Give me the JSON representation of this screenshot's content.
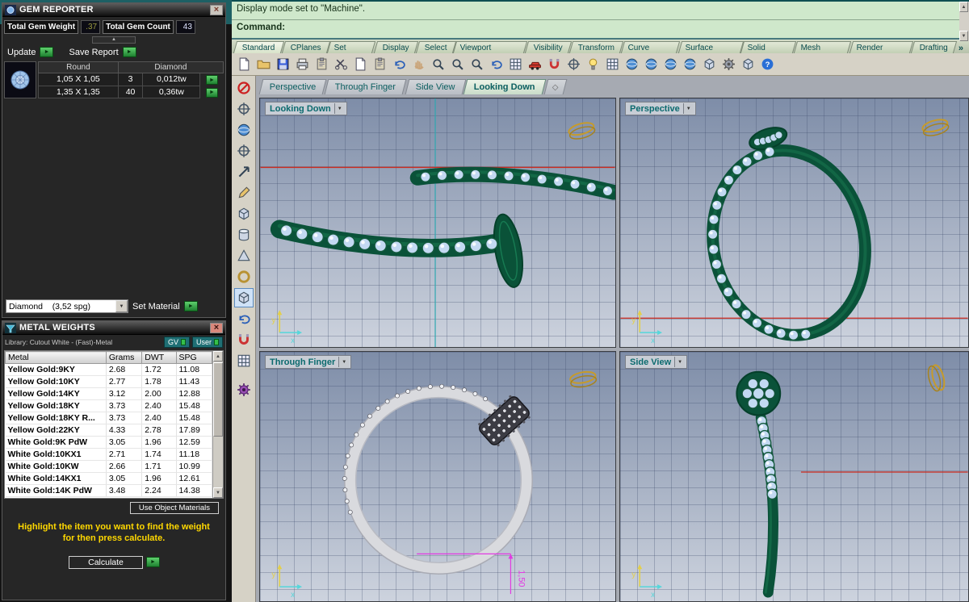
{
  "colors": {
    "accent_green": "#33a02c",
    "status_green": "#cfe8cb",
    "teal_text": "#0b5e60",
    "ring_green": "#0a5239",
    "gem_blue": "#c3d9f2",
    "gold": "#c79b2a",
    "magenta": "#e23ae2",
    "axis_red": "#cc2a1e"
  },
  "gem_reporter": {
    "title": "GEM REPORTER",
    "close_label": "×",
    "total_weight_label": "Total Gem Weight",
    "total_weight_value": ".37",
    "total_count_label": "Total Gem Count",
    "total_count_value": "43",
    "update_label": "Update",
    "save_report_label": "Save Report",
    "table": {
      "shape_header": "Round",
      "type_header": "Diamond",
      "rows": [
        {
          "size": "1,05 X 1,05",
          "count": "3",
          "weight": "0,012tw"
        },
        {
          "size": "1,35 X 1,35",
          "count": "40",
          "weight": "0,36tw"
        }
      ]
    },
    "material_value": "Diamond    (3,52 spg)",
    "set_material_label": "Set Material"
  },
  "metal_weights": {
    "title": "METAL WEIGHTS",
    "close_label": "×",
    "library_label": "Library: Cutout White - (Fast)-Metal",
    "gv_label": "GV",
    "user_label": "User",
    "columns": [
      "Metal",
      "Grams",
      "DWT",
      "SPG"
    ],
    "rows": [
      [
        "Yellow Gold:9KY",
        "2.68",
        "1.72",
        "11.08"
      ],
      [
        "Yellow Gold:10KY",
        "2.77",
        "1.78",
        "11.43"
      ],
      [
        "Yellow Gold:14KY",
        "3.12",
        "2.00",
        "12.88"
      ],
      [
        "Yellow Gold:18KY",
        "3.73",
        "2.40",
        "15.48"
      ],
      [
        "Yellow Gold:18KY R...",
        "3.73",
        "2.40",
        "15.48"
      ],
      [
        "Yellow Gold:22KY",
        "4.33",
        "2.78",
        "17.89"
      ],
      [
        "White Gold:9K PdW",
        "3.05",
        "1.96",
        "12.59"
      ],
      [
        "White Gold:10KX1",
        "2.71",
        "1.74",
        "11.18"
      ],
      [
        "White Gold:10KW",
        "2.66",
        "1.71",
        "10.99"
      ],
      [
        "White Gold:14KX1",
        "3.05",
        "1.96",
        "12.61"
      ],
      [
        "White Gold:14K PdW",
        "3.48",
        "2.24",
        "14.38"
      ]
    ],
    "use_object_materials_label": "Use Object Materials",
    "hint_line1": "Highlight the item you want to find the weight",
    "hint_line2": "for then press calculate.",
    "calculate_label": "Calculate"
  },
  "command_area": {
    "history_line": "Display mode set to \"Machine\".",
    "prompt_label": "Command:"
  },
  "menu": {
    "active": "Standard",
    "overflow_label": "»",
    "tabs": [
      "Standard",
      "CPlanes",
      "Set View",
      "Display",
      "Select",
      "Viewport Layout",
      "Visibility",
      "Transform",
      "Curve Tools",
      "Surface Tools",
      "Solid Tools",
      "Mesh Tools",
      "Render Tools",
      "Drafting"
    ]
  },
  "toolbar": {
    "icons": [
      {
        "name": "new-file",
        "sym": "s-page"
      },
      {
        "name": "open-file",
        "sym": "s-folder"
      },
      {
        "name": "save",
        "sym": "s-disk"
      },
      {
        "name": "print",
        "sym": "s-printer"
      },
      {
        "name": "copy-clipboard",
        "sym": "s-clipboard"
      },
      {
        "name": "cut",
        "sym": "s-scissors"
      },
      {
        "name": "copy",
        "sym": "s-page"
      },
      {
        "name": "paste",
        "sym": "s-clipboard"
      },
      {
        "name": "undo",
        "sym": "s-undo"
      },
      {
        "name": "pan-view",
        "sym": "s-hand"
      },
      {
        "name": "zoom-dynamic",
        "sym": "s-zoom"
      },
      {
        "name": "zoom-window",
        "sym": "s-zoom"
      },
      {
        "name": "zoom-extents",
        "sym": "s-zoom"
      },
      {
        "name": "rotate-view",
        "sym": "s-undo"
      },
      {
        "name": "four-viewports",
        "sym": "s-grid"
      },
      {
        "name": "boxedit",
        "sym": "s-car"
      },
      {
        "name": "osnap-toggle",
        "sym": "s-magnet"
      },
      {
        "name": "record-history",
        "sym": "s-target"
      },
      {
        "name": "lights",
        "sym": "s-bulb"
      },
      {
        "name": "layers",
        "sym": "s-grid"
      },
      {
        "name": "render",
        "sym": "s-sphere"
      },
      {
        "name": "render-preview",
        "sym": "s-sphere"
      },
      {
        "name": "materials",
        "sym": "s-sphere"
      },
      {
        "name": "environment",
        "sym": "s-sphere"
      },
      {
        "name": "ground-plane",
        "sym": "s-cube"
      },
      {
        "name": "options-gear",
        "sym": "s-gear"
      },
      {
        "name": "workspace",
        "sym": "s-cube"
      },
      {
        "name": "help",
        "sym": "s-help"
      }
    ]
  },
  "side_toolbar": {
    "icons": [
      {
        "name": "filter-disable",
        "sym": "s-noentry"
      },
      {
        "name": "cplane-target",
        "sym": "s-target"
      },
      {
        "name": "view-globe",
        "sym": "s-sphere"
      },
      {
        "name": "axis-tool",
        "sym": "s-target"
      },
      {
        "name": "move-tool",
        "sym": "s-arrow"
      },
      {
        "name": "curve-pencil",
        "sym": "s-pencil"
      },
      {
        "name": "box-tool",
        "sym": "s-cube"
      },
      {
        "name": "cylinder-tool",
        "sym": "s-cyl"
      },
      {
        "name": "pyramid-tool",
        "sym": "s-pyramid"
      },
      {
        "name": "torus-tool",
        "sym": "s-torus"
      },
      {
        "name": "surface-tool",
        "sym": "s-cube",
        "mod": "selected"
      },
      {
        "name": "sweep-tool",
        "sym": "s-undo"
      },
      {
        "name": "magnet-osnap",
        "sym": "s-magnet"
      },
      {
        "name": "checker-display",
        "sym": "s-grid"
      },
      {
        "name": "matrix-gear",
        "sym": "s-gearp",
        "mod": "gap-top"
      }
    ]
  },
  "viewport_tabs": {
    "active": "Looking Down",
    "new_tab_glyph": "◇",
    "tabs": [
      "Perspective",
      "Through Finger",
      "Side View",
      "Looking Down"
    ]
  },
  "viewports": {
    "top_left": {
      "title": "Looking Down"
    },
    "top_right": {
      "title": "Perspective"
    },
    "bottom_left": {
      "title": "Through Finger",
      "dimension_label": "1,50"
    },
    "bottom_right": {
      "title": "Side View"
    }
  },
  "axes": {
    "x_label": "x",
    "y_label": "y"
  }
}
